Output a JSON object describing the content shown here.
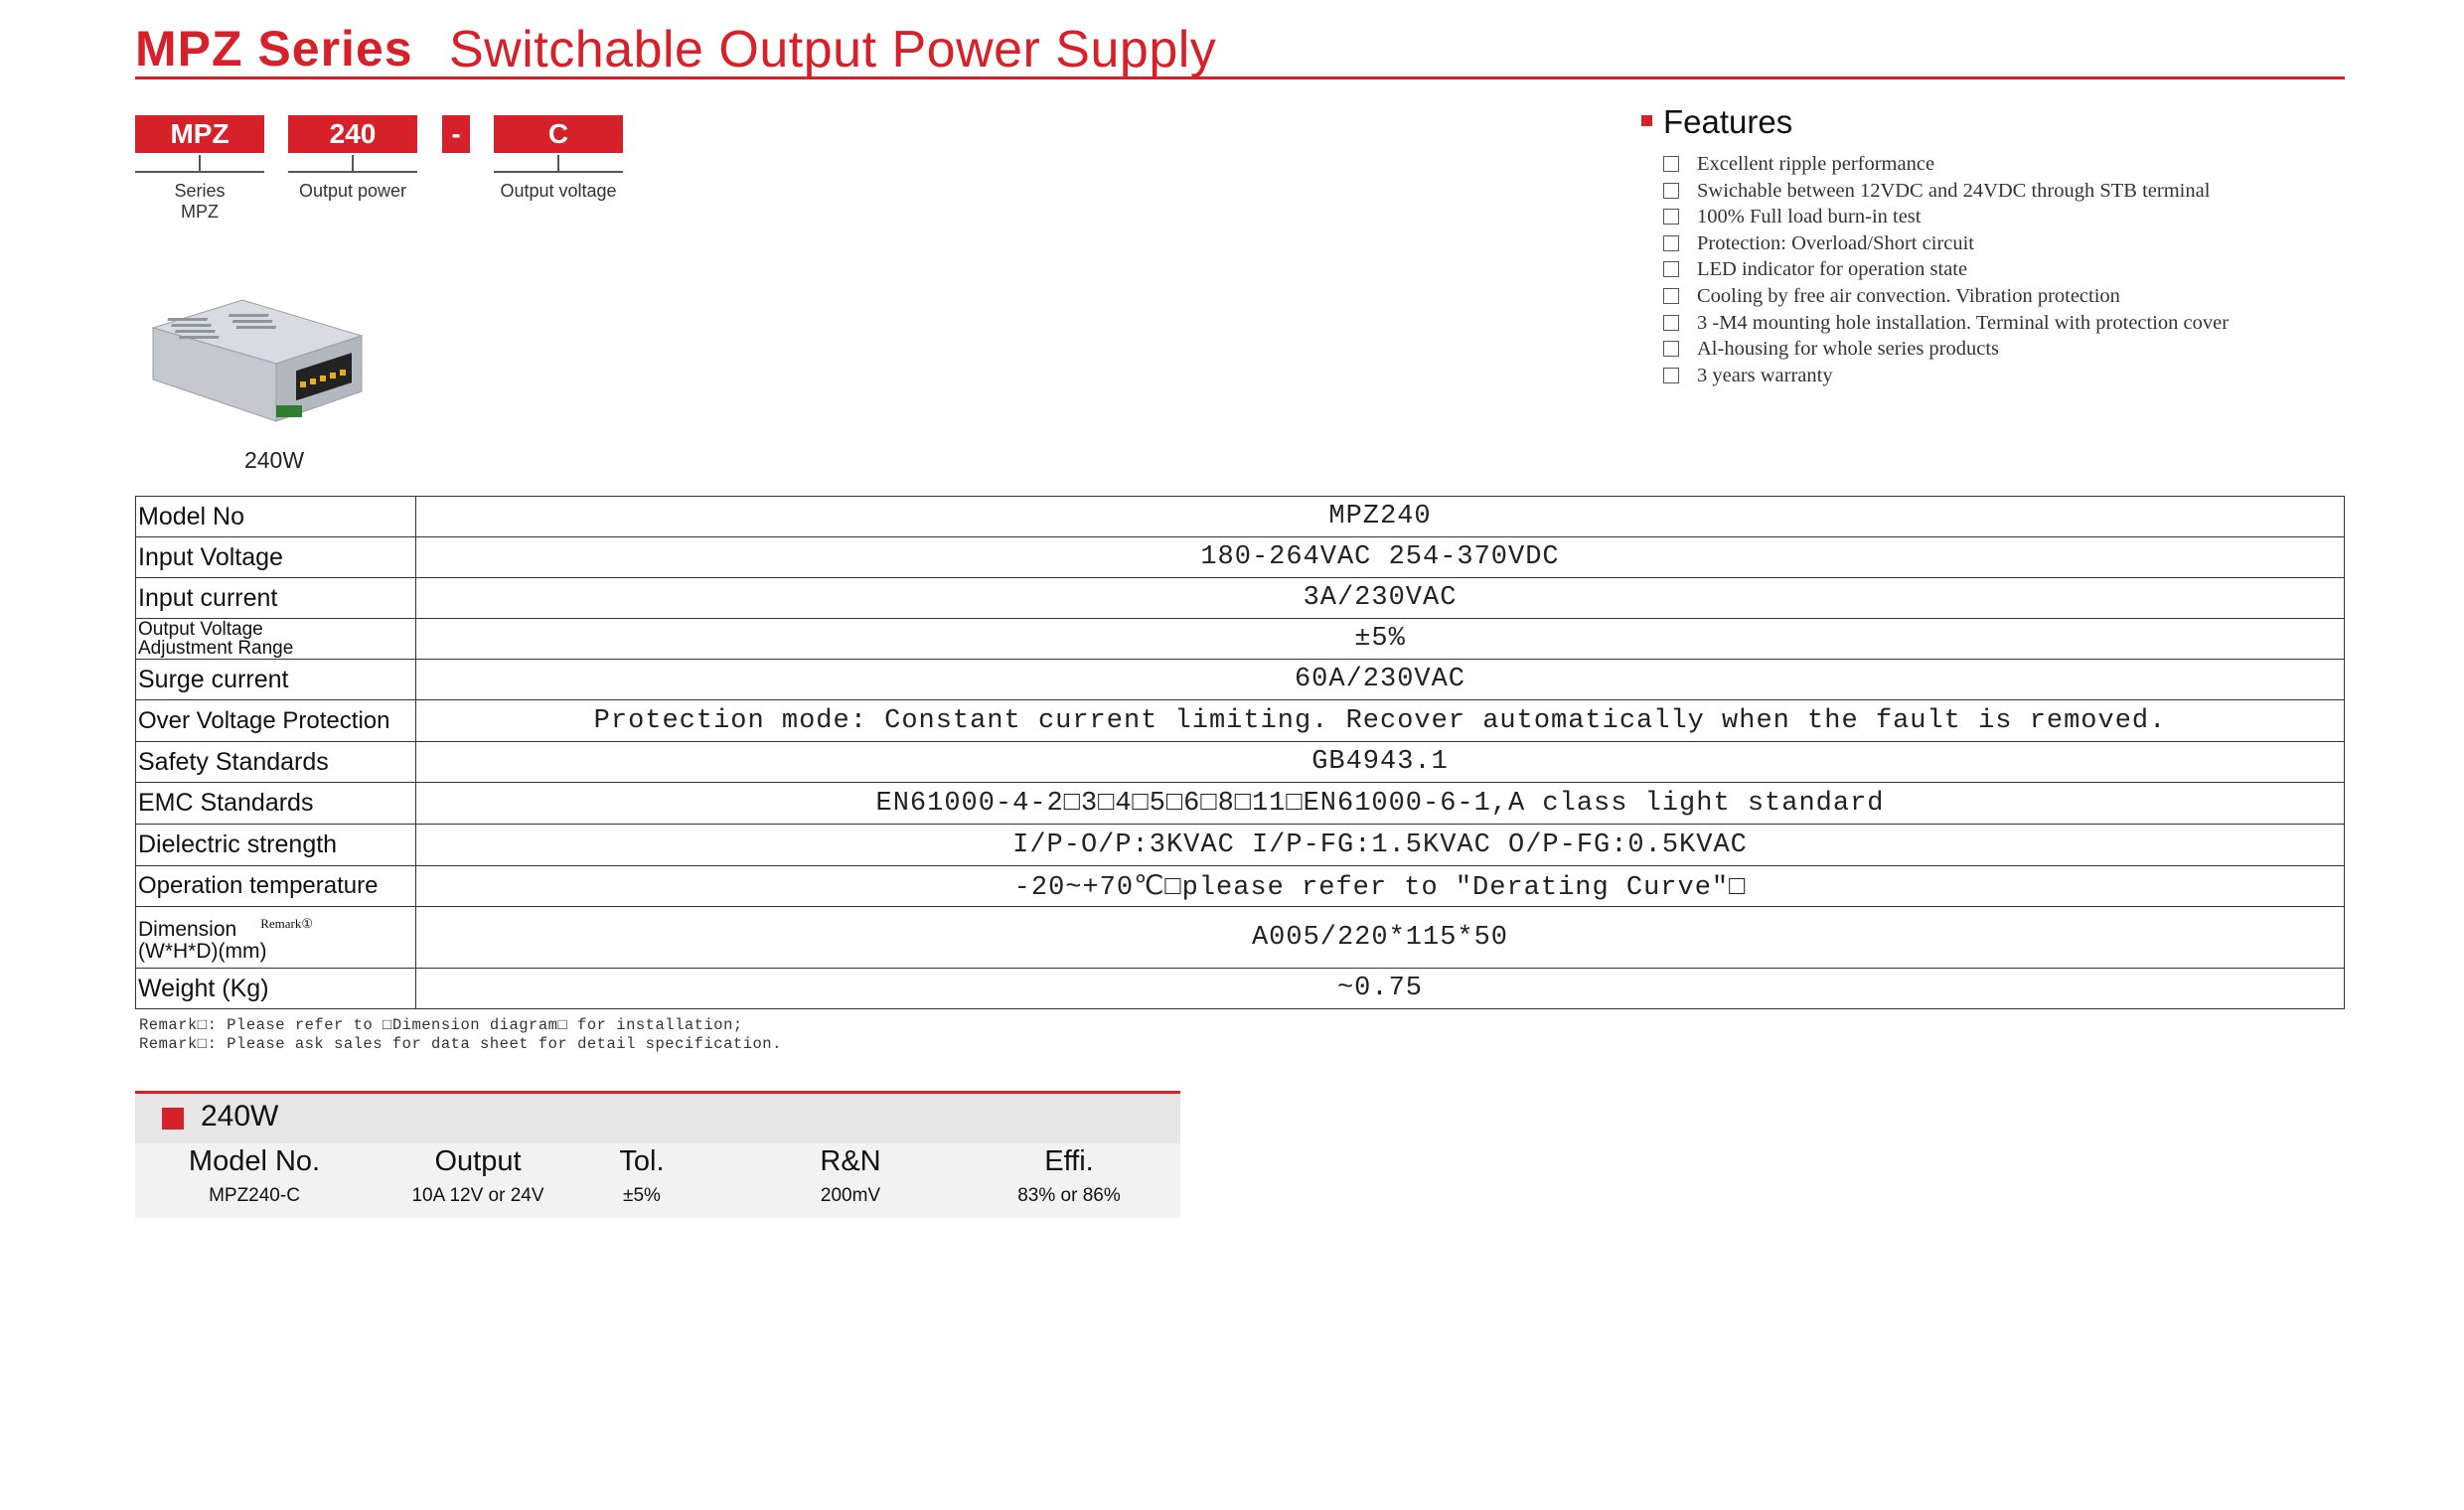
{
  "header": {
    "series_label": "MPZ Series",
    "title": "Switchable Output Power Supply"
  },
  "model_code": {
    "boxes": [
      "MPZ",
      "240",
      "-",
      "C"
    ],
    "labels": {
      "series": "Series",
      "series_value": "MPZ",
      "output_power": "Output power",
      "output_voltage": "Output voltage"
    }
  },
  "product": {
    "caption": "240W"
  },
  "features": {
    "title": "Features",
    "items": [
      "Excellent ripple performance",
      "Swichable between 12VDC and 24VDC through STB terminal",
      "100% Full load burn-in test",
      "Protection: Overload/Short circuit",
      "LED indicator for operation state",
      "Cooling by free air convection. Vibration protection",
      "3 -M4 mounting hole installation. Terminal with protection cover",
      "Al-housing for whole series products",
      "3 years warranty"
    ]
  },
  "spec_table": {
    "rows": [
      {
        "label": "Model No",
        "value": "MPZ240"
      },
      {
        "label": "Input Voltage",
        "value": "180-264VAC 254-370VDC"
      },
      {
        "label": "Input current",
        "value": "3A/230VAC"
      },
      {
        "label": "Output Voltage Adjustment Range",
        "label_line1": "Output Voltage",
        "label_line2": "Adjustment Range",
        "value": "±5%"
      },
      {
        "label": "Surge current",
        "value": "60A/230VAC"
      },
      {
        "label": "Over Voltage Protection",
        "value": "Protection mode: Constant current limiting. Recover automatically when the fault is removed."
      },
      {
        "label": "Safety Standards",
        "value": "GB4943.1"
      },
      {
        "label": "EMC Standards",
        "value": "EN61000-4-2□3□4□5□6□8□11□EN61000-6-1,A class light standard"
      },
      {
        "label": "Dielectric strength",
        "value": "I/P-O/P:3KVAC I/P-FG:1.5KVAC O/P-FG:0.5KVAC"
      },
      {
        "label": "Operation temperature",
        "value": "-20~+70℃□please refer to \"Derating Curve\"□"
      },
      {
        "label": "Dimension (W*H*D)(mm)",
        "label_line1": "Dimension",
        "label_line2": "(W*H*D)(mm)",
        "remark": "Remark①",
        "value": "A005/220*115*50"
      },
      {
        "label": "Weight (Kg)",
        "value": "~0.75"
      }
    ]
  },
  "remarks": [
    "Remark□: Please refer to □Dimension diagram□ for installation;",
    "Remark□: Please ask sales for data sheet for detail specification."
  ],
  "model_table": {
    "title": "240W",
    "columns": [
      "Model No.",
      "Output",
      "Tol.",
      "R&N",
      "Effi."
    ],
    "rows": [
      [
        "MPZ240-C",
        "10A 12V or 24V",
        "±5%",
        "200mV",
        "83% or 86%"
      ]
    ]
  },
  "colors": {
    "brand_red": "#d6202a",
    "table_border": "#333333",
    "model_table_bg": "#f2f2f2"
  }
}
